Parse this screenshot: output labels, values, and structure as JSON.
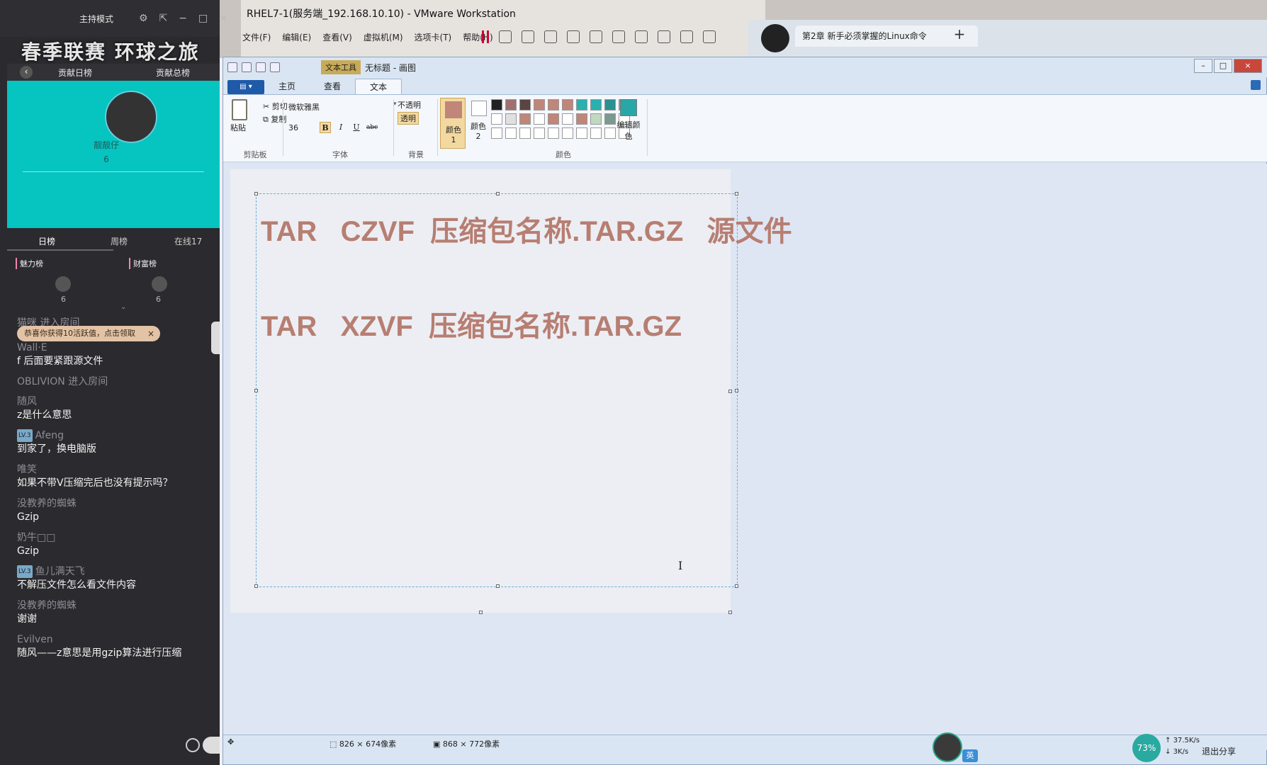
{
  "vmware": {
    "title": "RHEL7-1(服务端_192.168.10.10) - VMware Workstation",
    "menu": [
      "文件(F)",
      "编辑(E)",
      "查看(V)",
      "虚拟机(M)",
      "选项卡(T)",
      "帮助(H)"
    ]
  },
  "browser": {
    "tab_title": "第2章 新手必须掌握的Linux命令",
    "new_tab": "+"
  },
  "live": {
    "mode": "主持模式",
    "banner": "春季联赛 环球之旅",
    "back": "‹",
    "tab_day_rank": "贡献日榜",
    "tab_total_rank": "贡献总榜",
    "card_name": "靓靓仔",
    "card_value": "6",
    "subtab_day": "日榜",
    "subtab_week": "周榜",
    "subtab_online": "在线17",
    "charm_rank": "魅力榜",
    "wealth_rank": "财富榜",
    "rank_left_val": "6",
    "rank_right_val": "6",
    "system_notice": "猫咪 进入房间",
    "toast": "恭喜你获得10活跃值，点击领取",
    "toast_close": "×",
    "chat": [
      {
        "user": "Wall·E",
        "level": "",
        "text": "f 后面要紧跟源文件"
      },
      {
        "user": "OBLIVION 进入房间",
        "level": "",
        "text": ""
      },
      {
        "user": "随风",
        "level": "",
        "text": "z是什么意思"
      },
      {
        "user": "Afeng",
        "level": "LV.3",
        "text": "到家了，换电脑版"
      },
      {
        "user": "唯笑",
        "level": "",
        "text": "如果不带V压缩完后也没有提示吗？"
      },
      {
        "user": "没教养的蜘蛛",
        "level": "",
        "text": "Gzip"
      },
      {
        "user": "奶牛□□",
        "level": "",
        "text": "Gzip"
      },
      {
        "user": "鱼儿满天飞",
        "level": "LV.3",
        "text": "不解压文件怎么看文件内容"
      },
      {
        "user": "没教养的蜘蛛",
        "level": "",
        "text": "谢谢"
      },
      {
        "user": "Evilven",
        "level": "",
        "text": "随风——z意思是用gzip算法进行压缩"
      }
    ]
  },
  "paint": {
    "text_tools": "文本工具",
    "title": "无标题 - 画图",
    "tabs": [
      "主页",
      "查看",
      "文本"
    ],
    "active_tab": "文本",
    "clipboard": {
      "paste": "粘贴",
      "cut": "剪切",
      "copy": "复制",
      "label": "剪贴板"
    },
    "font": {
      "name": "微软雅黑",
      "size": "36",
      "label": "字体",
      "bold": "B",
      "italic": "I",
      "underline": "U",
      "strike": "abc"
    },
    "background": {
      "opaque": "不透明",
      "transparent": "透明",
      "label": "背景"
    },
    "colors": {
      "color1": "颜色 1",
      "color2": "颜色 2",
      "edit": "编辑颜色",
      "label": "颜色",
      "color1_value": "#c0867a",
      "palette": [
        "#222222",
        "#a07070",
        "#5a4444",
        "#c0867a",
        "#c0867a",
        "#c0867a",
        "#2ab0b0",
        "#2ab0b0",
        "#2a9090",
        "#c0867a",
        "#ffffff",
        "#e0e0e0",
        "#c0867a",
        "#ffffff",
        "#c0867a",
        "#ffffff",
        "#c0867a",
        "#c0d8c0",
        "#7a9a90",
        "#ffffff",
        "#ffffff",
        "#ffffff",
        "#ffffff",
        "#ffffff",
        "#ffffff",
        "#ffffff",
        "#ffffff",
        "#ffffff",
        "#ffffff",
        "#ffffff"
      ]
    },
    "canvas_lines": [
      "TAR   CZVF  压缩包名称.TAR.GZ   源文件",
      "TAR   XZVF  压缩包名称.TAR.GZ"
    ],
    "text_color": "#b77e72",
    "status": {
      "selection": "826 × 674像素",
      "canvas": "868 × 772像素"
    }
  },
  "taskbar": {
    "ime": "英",
    "net_percent": "73%",
    "upload": "37.5K/s",
    "download": "3K/s",
    "exit_share": "退出分享"
  }
}
